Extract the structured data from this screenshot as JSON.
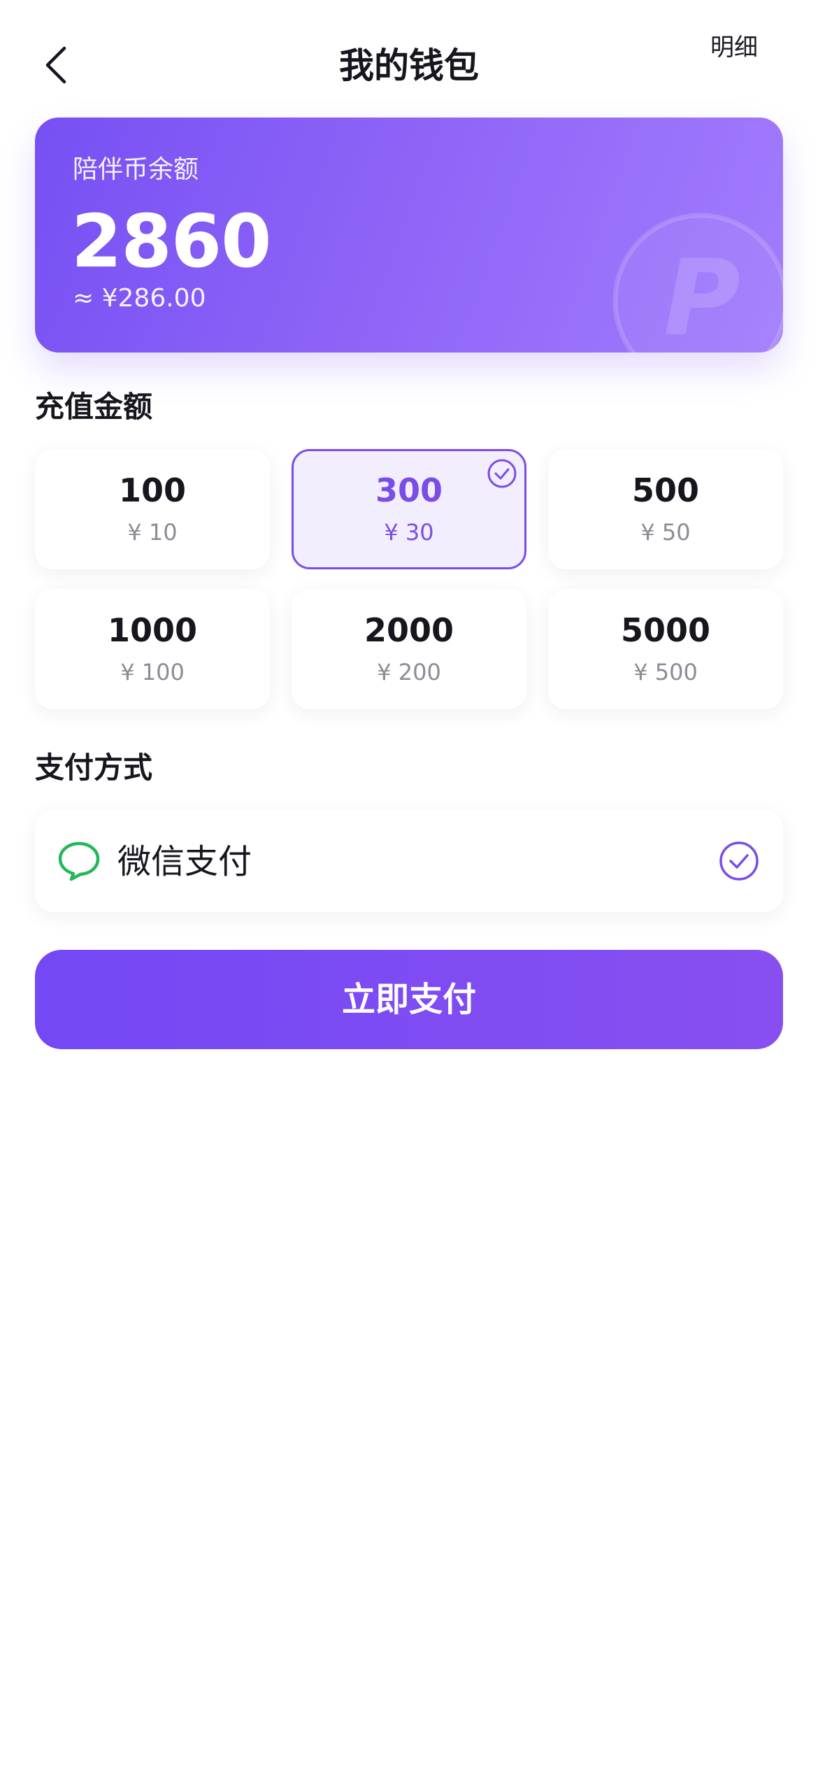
{
  "header": {
    "title": "我的钱包",
    "detail_label": "明细",
    "back_icon": "chevron-left-icon"
  },
  "balance": {
    "label": "陪伴币余额",
    "value": "2860",
    "cny_equivalent": "≈ ¥286.00",
    "watermark_icon": "p-coin-icon",
    "watermark_letter": "P"
  },
  "recharge": {
    "section_title": "充值金额",
    "selected_index": 1,
    "options": [
      {
        "coins": "100",
        "price": "¥ 10"
      },
      {
        "coins": "300",
        "price": "¥ 30"
      },
      {
        "coins": "500",
        "price": "¥ 50"
      },
      {
        "coins": "1000",
        "price": "¥ 100"
      },
      {
        "coins": "2000",
        "price": "¥ 200"
      },
      {
        "coins": "5000",
        "price": "¥ 500"
      }
    ]
  },
  "payment": {
    "section_title": "支付方式",
    "method_name": "微信支付",
    "method_icon": "wechat-icon",
    "selected": true
  },
  "submit": {
    "label": "立即支付"
  },
  "colors": {
    "accent": "#7a4de6",
    "card_gradient_start": "#7650f3",
    "card_gradient_end": "#a27cfd",
    "wechat_green": "#22b85a",
    "selected_bg": "#f3eefe"
  }
}
